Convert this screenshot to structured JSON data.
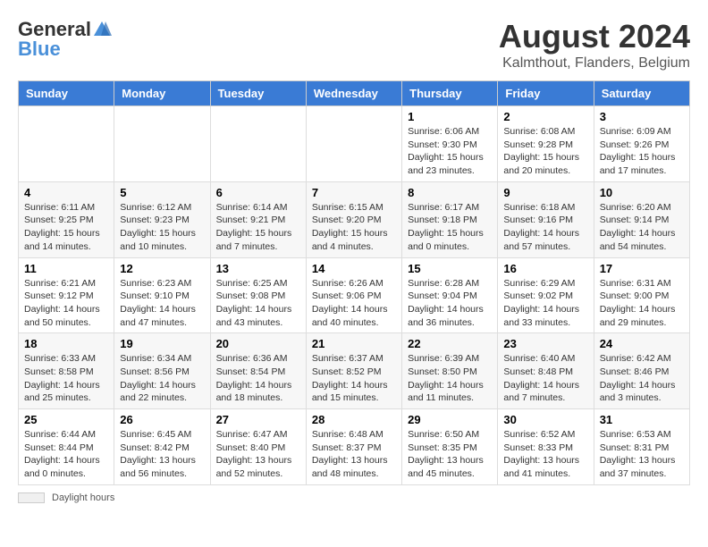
{
  "logo": {
    "general": "General",
    "blue": "Blue"
  },
  "title": "August 2024",
  "subtitle": "Kalmthout, Flanders, Belgium",
  "days_of_week": [
    "Sunday",
    "Monday",
    "Tuesday",
    "Wednesday",
    "Thursday",
    "Friday",
    "Saturday"
  ],
  "weeks": [
    [
      {
        "day": "",
        "info": ""
      },
      {
        "day": "",
        "info": ""
      },
      {
        "day": "",
        "info": ""
      },
      {
        "day": "",
        "info": ""
      },
      {
        "day": "1",
        "info": "Sunrise: 6:06 AM\nSunset: 9:30 PM\nDaylight: 15 hours and 23 minutes."
      },
      {
        "day": "2",
        "info": "Sunrise: 6:08 AM\nSunset: 9:28 PM\nDaylight: 15 hours and 20 minutes."
      },
      {
        "day": "3",
        "info": "Sunrise: 6:09 AM\nSunset: 9:26 PM\nDaylight: 15 hours and 17 minutes."
      }
    ],
    [
      {
        "day": "4",
        "info": "Sunrise: 6:11 AM\nSunset: 9:25 PM\nDaylight: 15 hours and 14 minutes."
      },
      {
        "day": "5",
        "info": "Sunrise: 6:12 AM\nSunset: 9:23 PM\nDaylight: 15 hours and 10 minutes."
      },
      {
        "day": "6",
        "info": "Sunrise: 6:14 AM\nSunset: 9:21 PM\nDaylight: 15 hours and 7 minutes."
      },
      {
        "day": "7",
        "info": "Sunrise: 6:15 AM\nSunset: 9:20 PM\nDaylight: 15 hours and 4 minutes."
      },
      {
        "day": "8",
        "info": "Sunrise: 6:17 AM\nSunset: 9:18 PM\nDaylight: 15 hours and 0 minutes."
      },
      {
        "day": "9",
        "info": "Sunrise: 6:18 AM\nSunset: 9:16 PM\nDaylight: 14 hours and 57 minutes."
      },
      {
        "day": "10",
        "info": "Sunrise: 6:20 AM\nSunset: 9:14 PM\nDaylight: 14 hours and 54 minutes."
      }
    ],
    [
      {
        "day": "11",
        "info": "Sunrise: 6:21 AM\nSunset: 9:12 PM\nDaylight: 14 hours and 50 minutes."
      },
      {
        "day": "12",
        "info": "Sunrise: 6:23 AM\nSunset: 9:10 PM\nDaylight: 14 hours and 47 minutes."
      },
      {
        "day": "13",
        "info": "Sunrise: 6:25 AM\nSunset: 9:08 PM\nDaylight: 14 hours and 43 minutes."
      },
      {
        "day": "14",
        "info": "Sunrise: 6:26 AM\nSunset: 9:06 PM\nDaylight: 14 hours and 40 minutes."
      },
      {
        "day": "15",
        "info": "Sunrise: 6:28 AM\nSunset: 9:04 PM\nDaylight: 14 hours and 36 minutes."
      },
      {
        "day": "16",
        "info": "Sunrise: 6:29 AM\nSunset: 9:02 PM\nDaylight: 14 hours and 33 minutes."
      },
      {
        "day": "17",
        "info": "Sunrise: 6:31 AM\nSunset: 9:00 PM\nDaylight: 14 hours and 29 minutes."
      }
    ],
    [
      {
        "day": "18",
        "info": "Sunrise: 6:33 AM\nSunset: 8:58 PM\nDaylight: 14 hours and 25 minutes."
      },
      {
        "day": "19",
        "info": "Sunrise: 6:34 AM\nSunset: 8:56 PM\nDaylight: 14 hours and 22 minutes."
      },
      {
        "day": "20",
        "info": "Sunrise: 6:36 AM\nSunset: 8:54 PM\nDaylight: 14 hours and 18 minutes."
      },
      {
        "day": "21",
        "info": "Sunrise: 6:37 AM\nSunset: 8:52 PM\nDaylight: 14 hours and 15 minutes."
      },
      {
        "day": "22",
        "info": "Sunrise: 6:39 AM\nSunset: 8:50 PM\nDaylight: 14 hours and 11 minutes."
      },
      {
        "day": "23",
        "info": "Sunrise: 6:40 AM\nSunset: 8:48 PM\nDaylight: 14 hours and 7 minutes."
      },
      {
        "day": "24",
        "info": "Sunrise: 6:42 AM\nSunset: 8:46 PM\nDaylight: 14 hours and 3 minutes."
      }
    ],
    [
      {
        "day": "25",
        "info": "Sunrise: 6:44 AM\nSunset: 8:44 PM\nDaylight: 14 hours and 0 minutes."
      },
      {
        "day": "26",
        "info": "Sunrise: 6:45 AM\nSunset: 8:42 PM\nDaylight: 13 hours and 56 minutes."
      },
      {
        "day": "27",
        "info": "Sunrise: 6:47 AM\nSunset: 8:40 PM\nDaylight: 13 hours and 52 minutes."
      },
      {
        "day": "28",
        "info": "Sunrise: 6:48 AM\nSunset: 8:37 PM\nDaylight: 13 hours and 48 minutes."
      },
      {
        "day": "29",
        "info": "Sunrise: 6:50 AM\nSunset: 8:35 PM\nDaylight: 13 hours and 45 minutes."
      },
      {
        "day": "30",
        "info": "Sunrise: 6:52 AM\nSunset: 8:33 PM\nDaylight: 13 hours and 41 minutes."
      },
      {
        "day": "31",
        "info": "Sunrise: 6:53 AM\nSunset: 8:31 PM\nDaylight: 13 hours and 37 minutes."
      }
    ]
  ],
  "footer": {
    "label": "Daylight hours"
  },
  "colors": {
    "header_bg": "#3a7bd5",
    "header_text": "#ffffff",
    "border": "#dddddd"
  }
}
